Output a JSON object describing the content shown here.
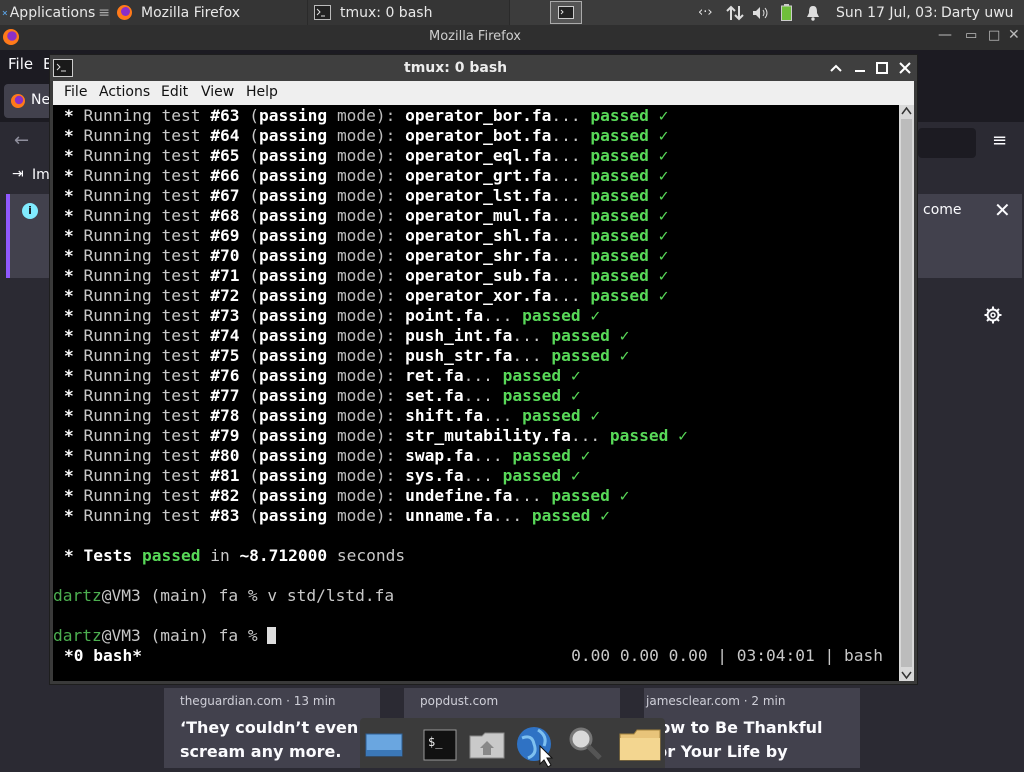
{
  "panel": {
    "applications_label": "Applications",
    "tasks": [
      {
        "label": "Mozilla Firefox",
        "icon": "firefox-icon"
      },
      {
        "label": "tmux: 0 bash",
        "icon": "terminal-icon"
      }
    ],
    "clock": "Sun 17 Jul, 03:04",
    "user": "Darty uwu"
  },
  "firefox": {
    "window_title": "Mozilla Firefox",
    "menu_file": "File",
    "menu_e": "E",
    "tab_label": "Ne",
    "bookmark_label": "Im",
    "notice_text": "come",
    "cards": [
      {
        "source": "theguardian.com · 13 min",
        "headline": "‘They couldn’t even scream any more."
      },
      {
        "source": "popdust.com",
        "headline": ""
      },
      {
        "source": "jamesclear.com · 2 min",
        "headline": "How to Be Thankful For Your Life by"
      }
    ]
  },
  "terminal": {
    "title": "tmux: 0 bash",
    "menu": [
      "File",
      "Actions",
      "Edit",
      "View",
      "Help"
    ],
    "tests": [
      {
        "num": "#63",
        "file": "operator_bor.fa"
      },
      {
        "num": "#64",
        "file": "operator_bot.fa"
      },
      {
        "num": "#65",
        "file": "operator_eql.fa"
      },
      {
        "num": "#66",
        "file": "operator_grt.fa"
      },
      {
        "num": "#67",
        "file": "operator_lst.fa"
      },
      {
        "num": "#68",
        "file": "operator_mul.fa"
      },
      {
        "num": "#69",
        "file": "operator_shl.fa"
      },
      {
        "num": "#70",
        "file": "operator_shr.fa"
      },
      {
        "num": "#71",
        "file": "operator_sub.fa"
      },
      {
        "num": "#72",
        "file": "operator_xor.fa"
      },
      {
        "num": "#73",
        "file": "point.fa"
      },
      {
        "num": "#74",
        "file": "push_int.fa"
      },
      {
        "num": "#75",
        "file": "push_str.fa"
      },
      {
        "num": "#76",
        "file": "ret.fa"
      },
      {
        "num": "#77",
        "file": "set.fa"
      },
      {
        "num": "#78",
        "file": "shift.fa"
      },
      {
        "num": "#79",
        "file": "str_mutability.fa"
      },
      {
        "num": "#80",
        "file": "swap.fa"
      },
      {
        "num": "#81",
        "file": "sys.fa"
      },
      {
        "num": "#82",
        "file": "undefine.fa"
      },
      {
        "num": "#83",
        "file": "unname.fa"
      }
    ],
    "strings": {
      "bullet": "*",
      "running": "Running test",
      "mode_open": "(",
      "mode_word": "passing",
      "mode_rest": "mode):",
      "dots": "...",
      "passed": "passed",
      "check": "✓"
    },
    "summary": {
      "prefix": "* Tests ",
      "passed": "passed",
      "in": " in ",
      "time": "~8.712000",
      "suffix": " seconds"
    },
    "prompt1": {
      "user": "dartz",
      "host": "@VM3 (main) fa % ",
      "command": "v std/lstd.fa"
    },
    "prompt2": {
      "user": "dartz",
      "host": "@VM3 (main) fa % "
    },
    "status": {
      "left": "*0 bash*",
      "right": "0.00 0.00 0.00 | 03:04:01 | bash"
    }
  },
  "colors": {
    "pass_green": "#58d858",
    "prompt_green": "#4caf50",
    "accent": "#9059ff"
  }
}
